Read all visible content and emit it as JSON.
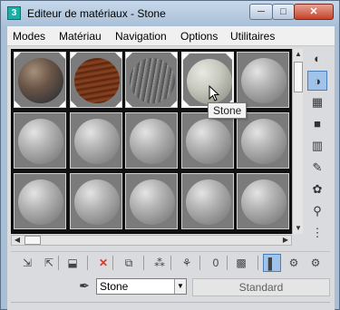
{
  "window": {
    "title": "Editeur de matériaux - Stone",
    "app_icon_glyph": "3",
    "min_glyph": "─",
    "max_glyph": "□",
    "close_glyph": "✕"
  },
  "menu": [
    "Modes",
    "Matériau",
    "Navigation",
    "Options",
    "Utilitaires"
  ],
  "slots": [
    {
      "material": "rock",
      "active": false
    },
    {
      "material": "wood-dark",
      "active": false
    },
    {
      "material": "wood-grey",
      "active": false
    },
    {
      "material": "stone",
      "active": true
    },
    {
      "material": "default",
      "active": false
    },
    {
      "material": "default",
      "active": false
    },
    {
      "material": "default",
      "active": false
    },
    {
      "material": "default",
      "active": false
    },
    {
      "material": "default",
      "active": false
    },
    {
      "material": "default",
      "active": false
    },
    {
      "material": "default",
      "active": false
    },
    {
      "material": "default",
      "active": false
    },
    {
      "material": "default",
      "active": false
    },
    {
      "material": "default",
      "active": false
    },
    {
      "material": "default",
      "active": false
    }
  ],
  "tooltip": "Stone",
  "material_name": "Stone",
  "material_type": "Standard",
  "side_toolbar": [
    {
      "icon": "sample-type-sphere-icon",
      "glyph": "◐",
      "on": false
    },
    {
      "icon": "backlight-icon",
      "glyph": "◑",
      "on": true
    },
    {
      "icon": "background-checker-icon",
      "glyph": "▦",
      "on": false
    },
    {
      "icon": "sample-uv-tiling-icon",
      "glyph": "■",
      "on": false
    },
    {
      "icon": "video-color-check-icon",
      "glyph": "▥",
      "on": false
    },
    {
      "icon": "make-preview-icon",
      "glyph": "✎",
      "on": false
    },
    {
      "icon": "options-icon",
      "glyph": "✿",
      "on": false
    },
    {
      "icon": "select-by-material-icon",
      "glyph": "⚲",
      "on": false
    },
    {
      "icon": "material-map-navigator-icon",
      "glyph": "⋮",
      "on": false
    }
  ],
  "bottom_toolbar": [
    {
      "icon": "get-material-icon",
      "glyph": "⇲"
    },
    {
      "icon": "put-to-scene-icon",
      "glyph": "⇱"
    },
    {
      "icon": "assign-to-selection-icon",
      "glyph": "⬓"
    },
    {
      "icon": "delete-icon",
      "glyph": "✕"
    },
    {
      "icon": "copy-material-icon",
      "glyph": "⧉"
    },
    {
      "icon": "make-unique-icon",
      "glyph": "⁂"
    },
    {
      "icon": "put-to-library-icon",
      "glyph": "⚘"
    },
    {
      "icon": "material-id-channel-icon",
      "glyph": "0"
    },
    {
      "icon": "show-map-in-viewport-icon",
      "glyph": "▩"
    },
    {
      "icon": "show-end-result-icon",
      "glyph": "▌"
    },
    {
      "icon": "go-to-parent-icon",
      "glyph": "⚙"
    },
    {
      "icon": "go-forward-to-sibling-icon",
      "glyph": "⚙"
    }
  ],
  "colors": {
    "titlebar_top": "#c7d8ea",
    "close_button": "#c6422b",
    "toggle_on": "#9fc3ea",
    "delete_red": "#d43a2a"
  }
}
